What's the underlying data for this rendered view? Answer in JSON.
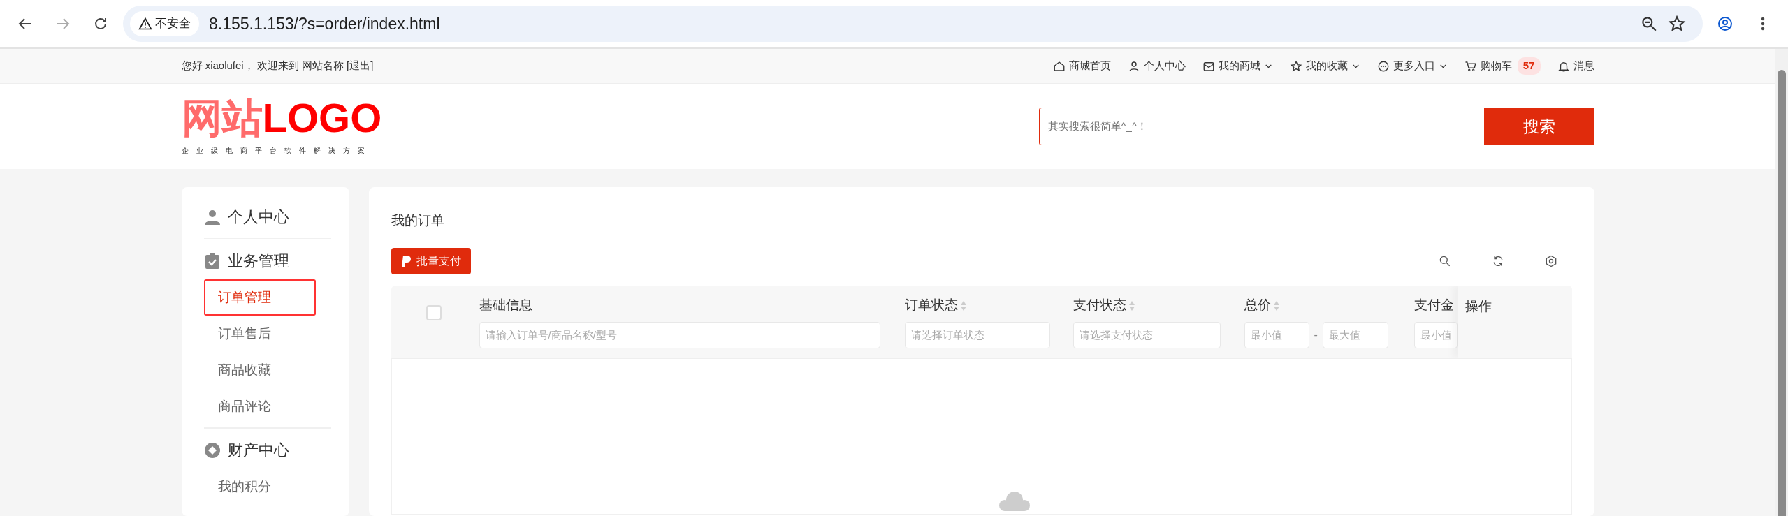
{
  "browser": {
    "security_label": "不安全",
    "url": "8.155.1.153/?s=order/index.html"
  },
  "top_bar": {
    "greeting": "您好 xiaolufei， 欢迎来到 网站名称",
    "logout": "[退出]",
    "links": [
      {
        "kind": "home",
        "label": "商城首页",
        "dropdown": false
      },
      {
        "kind": "person",
        "label": "个人中心",
        "dropdown": false
      },
      {
        "kind": "mail",
        "label": "我的商城",
        "dropdown": true
      },
      {
        "kind": "star",
        "label": "我的收藏",
        "dropdown": true
      },
      {
        "kind": "more",
        "label": "更多入口",
        "dropdown": true
      },
      {
        "kind": "cart",
        "label": "购物车",
        "dropdown": false,
        "badge": "57"
      },
      {
        "kind": "bell",
        "label": "消息",
        "dropdown": false
      }
    ]
  },
  "header": {
    "logo_main": "网站",
    "logo_accent": "LOGO",
    "tagline": "企业级电商平台软件解决方案",
    "search": {
      "placeholder": "其实搜索很简单^_^！",
      "button": "搜索"
    }
  },
  "sidebar": {
    "sections": [
      {
        "kind": "person",
        "title": "个人中心"
      },
      {
        "kind": "clipboard",
        "title": "业务管理",
        "items": [
          {
            "label": "订单管理",
            "selected": true
          },
          {
            "label": "订单售后",
            "selected": false
          },
          {
            "label": "商品收藏",
            "selected": false
          },
          {
            "label": "商品评论",
            "selected": false
          }
        ]
      },
      {
        "kind": "coin",
        "title": "财产中心",
        "items": [
          {
            "label": "我的积分",
            "selected": false
          }
        ]
      }
    ]
  },
  "main": {
    "title": "我的订单",
    "batch_button": "批量支付",
    "table": {
      "select_all": {
        "checked": false
      },
      "columns": [
        {
          "label": "基础信息",
          "sortable": false,
          "filter": {
            "kind": "text",
            "placeholder": "请输入订单号/商品名称/型号"
          }
        },
        {
          "label": "订单状态",
          "sortable": true,
          "filter": {
            "kind": "select",
            "placeholder": "请选择订单状态"
          }
        },
        {
          "label": "支付状态",
          "sortable": true,
          "filter": {
            "kind": "select",
            "placeholder": "请选择支付状态"
          }
        },
        {
          "label": "总价",
          "sortable": true,
          "filter": {
            "kind": "range",
            "min_placeholder": "最小值",
            "separator": "-",
            "max_placeholder": "最大值"
          }
        },
        {
          "label": "支付金",
          "sortable": false,
          "filter": {
            "kind": "single",
            "placeholder": "最小值"
          }
        }
      ],
      "actions_column": "操作"
    }
  }
}
